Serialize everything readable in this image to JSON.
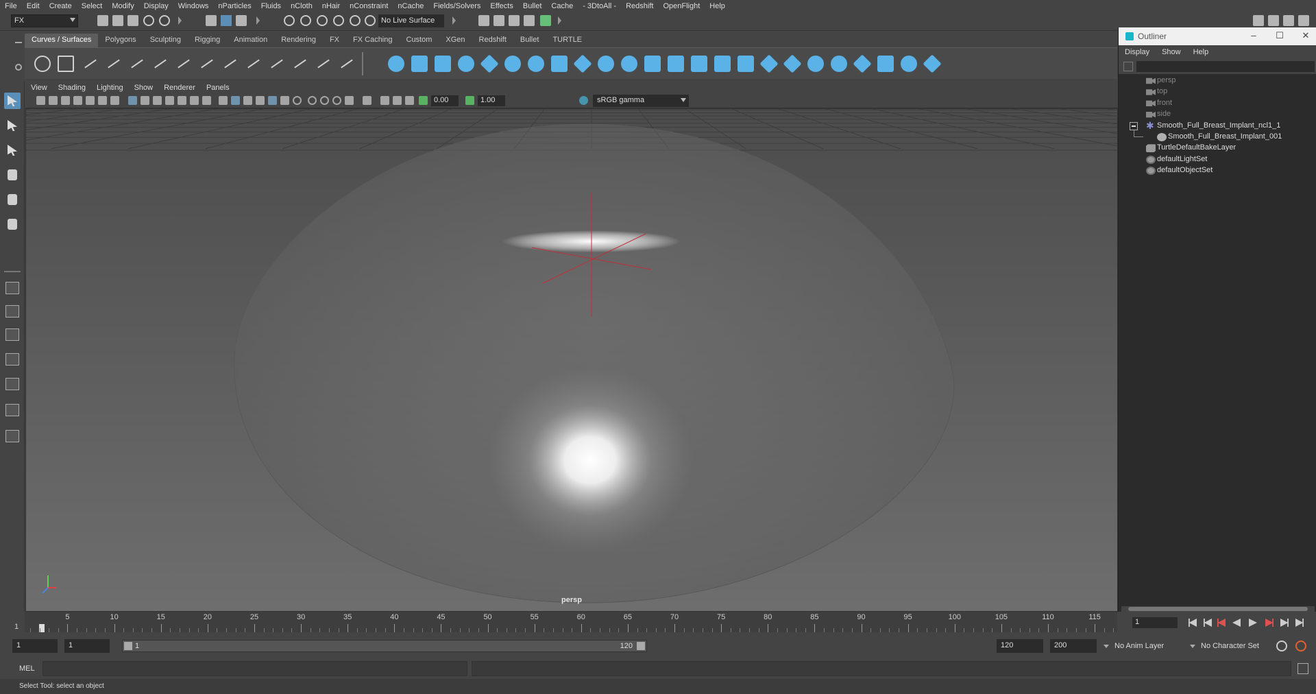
{
  "menubar": {
    "items": [
      "File",
      "Edit",
      "Create",
      "Select",
      "Modify",
      "Display",
      "Windows",
      "nParticles",
      "Fluids",
      "nCloth",
      "nHair",
      "nConstraint",
      "nCache",
      "Fields/Solvers",
      "Effects",
      "Bullet",
      "Cache",
      "- 3DtoAll -",
      "Redshift",
      "OpenFlight",
      "Help"
    ]
  },
  "statusline": {
    "mode": "FX",
    "live_surface": "No Live Surface"
  },
  "shelf": {
    "tabs": [
      "Curves / Surfaces",
      "Polygons",
      "Sculpting",
      "Rigging",
      "Animation",
      "Rendering",
      "FX",
      "FX Caching",
      "Custom",
      "XGen",
      "Redshift",
      "Bullet",
      "TURTLE"
    ],
    "active_tab": "Curves / Surfaces"
  },
  "panel": {
    "menu": [
      "View",
      "Shading",
      "Lighting",
      "Show",
      "Renderer",
      "Panels"
    ],
    "exposure": "0.00",
    "gamma_value": "1.00",
    "color_space": "sRGB gamma",
    "camera": "persp"
  },
  "outliner": {
    "title": "Outliner",
    "menu": [
      "Display",
      "Show",
      "Help"
    ],
    "items": [
      {
        "label": "persp",
        "icon": "camera-icon",
        "dim": true
      },
      {
        "label": "top",
        "icon": "camera-icon",
        "dim": true
      },
      {
        "label": "front",
        "icon": "camera-icon",
        "dim": true
      },
      {
        "label": "side",
        "icon": "camera-icon",
        "dim": true
      },
      {
        "label": "Smooth_Full_Breast_Implant_ncl1_1",
        "icon": "group-icon",
        "dim": false
      },
      {
        "label": "Smooth_Full_Breast_Implant_001",
        "icon": "mesh-icon",
        "dim": false
      },
      {
        "label": "TurtleDefaultBakeLayer",
        "icon": "layer-icon",
        "dim": false
      },
      {
        "label": "defaultLightSet",
        "icon": "set-icon",
        "dim": false
      },
      {
        "label": "defaultObjectSet",
        "icon": "set-icon",
        "dim": false
      }
    ]
  },
  "timeline": {
    "current_frame": "1",
    "ticks": [
      "5",
      "10",
      "15",
      "20",
      "25",
      "30",
      "35",
      "40",
      "45",
      "50",
      "55",
      "60",
      "65",
      "70",
      "75",
      "80",
      "85",
      "90",
      "95",
      "100",
      "105",
      "110",
      "115"
    ],
    "start_label": "1"
  },
  "range": {
    "start_time": "1",
    "playback_start": "1",
    "range_start": "1",
    "range_end": "120",
    "playback_end": "120",
    "end_time": "200",
    "anim_layer": "No Anim Layer",
    "character_set": "No Character Set"
  },
  "cmdline": {
    "label": "MEL"
  },
  "helpline": {
    "text": "Select Tool: select an object"
  }
}
